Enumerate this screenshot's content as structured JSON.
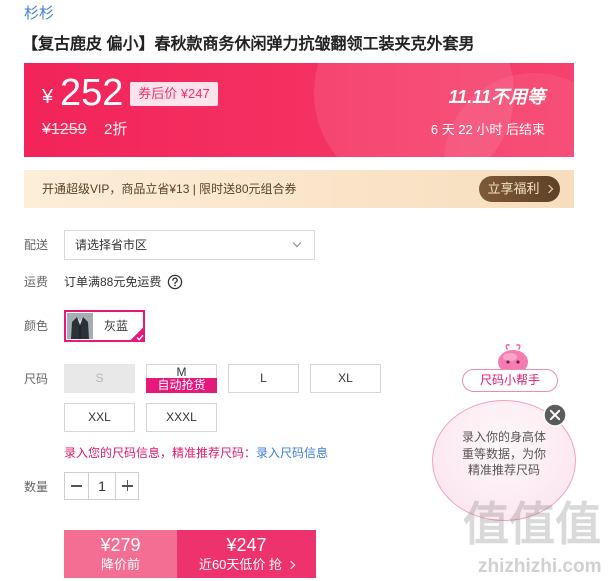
{
  "brand": {
    "name": "杉杉"
  },
  "product": {
    "title": "【复古鹿皮 偏小】春秋款商务休闲弹力抗皱翻领工装夹克外套男"
  },
  "price_banner": {
    "currency": "¥",
    "price": "252",
    "coupon_label": "券后价 ¥247",
    "original_price": "¥1259",
    "discount": "2折",
    "promo_title": "11.11不用等",
    "countdown": "6 天 22 小时 后结束"
  },
  "vip_bar": {
    "text": "开通超级VIP，商品立省¥13 | 限时送80元组合券",
    "button_label": "立享福利"
  },
  "delivery": {
    "label": "配送",
    "select_value": "请选择省市区"
  },
  "shipping": {
    "label": "运费",
    "text": "订单满88元免运费"
  },
  "color": {
    "label": "颜色",
    "options": [
      {
        "name": "灰蓝",
        "selected": true
      }
    ]
  },
  "size": {
    "label": "尺码",
    "options": [
      {
        "name": "S",
        "available": false
      },
      {
        "name": "M",
        "available": true,
        "badge": "自动抢货"
      },
      {
        "name": "L",
        "available": true
      },
      {
        "name": "XL",
        "available": true
      },
      {
        "name": "XXL",
        "available": true
      },
      {
        "name": "XXXL",
        "available": true
      }
    ],
    "hint": "录入您的尺码信息，精准推荐尺码：",
    "hint_link": "录入尺码信息"
  },
  "quantity": {
    "label": "数量",
    "value": "1"
  },
  "actions": {
    "before": {
      "price": "¥279",
      "label": "降价前"
    },
    "buy": {
      "price": "¥247",
      "label": "近60天低价 抢"
    }
  },
  "size_helper": {
    "title": "尺码小帮手",
    "bubble_text": "录入你的身高体重等数据，为你精准推荐尺码"
  },
  "watermark": {
    "logo": "值值值",
    "site": "zhizhizhi.com"
  },
  "icons": {
    "select": "chevron-down-icon",
    "help": "question-circle-icon",
    "selected": "check-icon",
    "arrow": "chevron-right-icon",
    "close": "close-icon",
    "quantity": [
      "minus-icon",
      "plus-icon"
    ]
  },
  "colors": {
    "accent": "#e6187a",
    "banner": "#f2245a",
    "link": "#3f7fd8",
    "vip_button": "#6f4c2d",
    "before_button": "#f46e93",
    "buy_button": "#ee326d"
  }
}
